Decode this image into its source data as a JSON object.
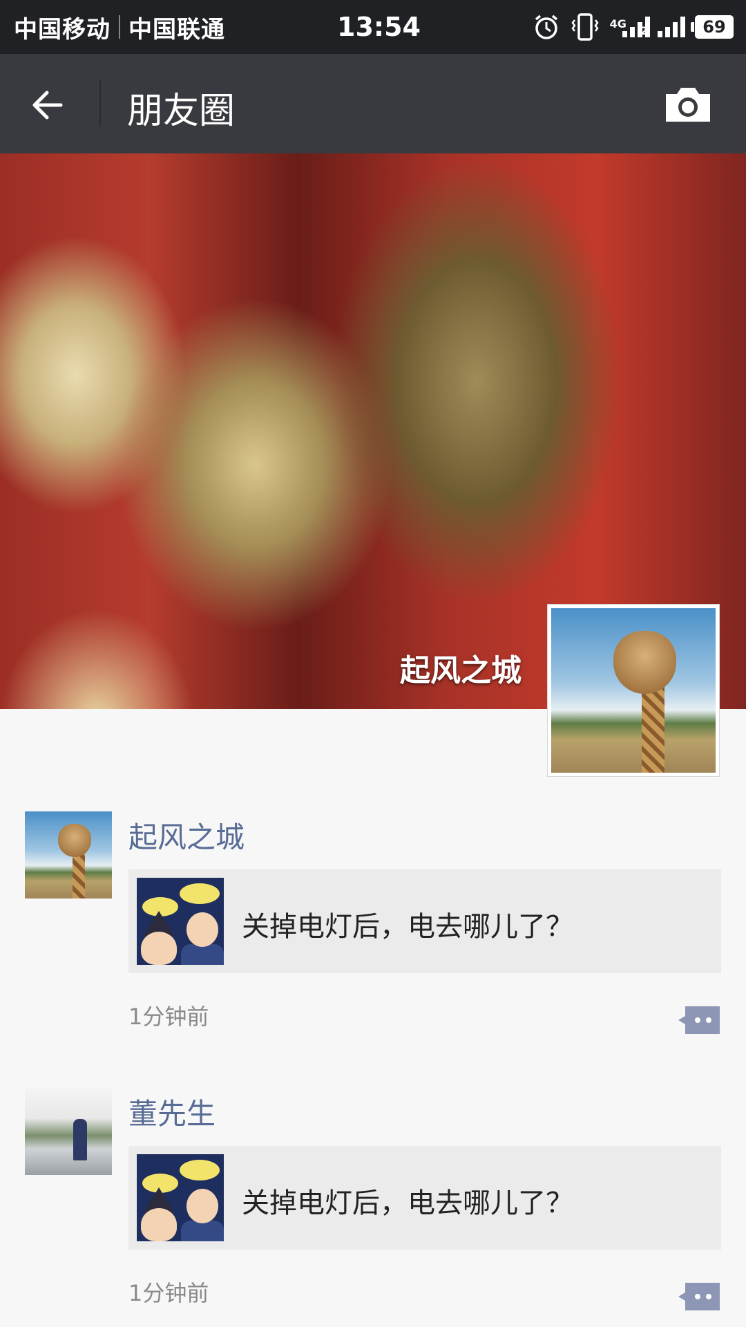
{
  "status_bar": {
    "carrier1": "中国移动",
    "carrier2": "中国联通",
    "time": "13:54",
    "network": "4G",
    "sim2_label": "2",
    "battery": "69",
    "icons": [
      "alarm-icon",
      "vibrate-icon",
      "signal-icon",
      "signal-icon",
      "battery-icon"
    ]
  },
  "header": {
    "title": "朋友圈",
    "back_icon": "back-arrow-icon",
    "camera_icon": "camera-icon"
  },
  "cover": {
    "user_name": "起风之城"
  },
  "feed": [
    {
      "name": "起风之城",
      "link_title": "关掉电灯后，电去哪儿了？",
      "time": "1分钟前"
    },
    {
      "name": "董先生",
      "link_title": "关掉电灯后，电去哪儿了？",
      "time": "1分钟前"
    }
  ]
}
